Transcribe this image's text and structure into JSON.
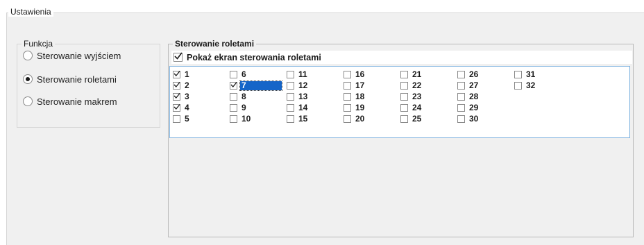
{
  "settings": {
    "title": "Ustawienia"
  },
  "funkcja": {
    "title": "Funkcja",
    "options": [
      {
        "label": "Sterowanie wyjściem",
        "selected": false
      },
      {
        "label": "Sterowanie roletami",
        "selected": true
      },
      {
        "label": "Sterowanie makrem",
        "selected": false
      }
    ]
  },
  "rolety": {
    "title": "Sterowanie roletami",
    "show_screen": {
      "label": "Pokaż ekran sterowania roletami",
      "checked": true
    },
    "focused_item": "7",
    "items": [
      {
        "label": "1",
        "checked": true
      },
      {
        "label": "2",
        "checked": true
      },
      {
        "label": "3",
        "checked": true
      },
      {
        "label": "4",
        "checked": true
      },
      {
        "label": "5",
        "checked": false
      },
      {
        "label": "6",
        "checked": false
      },
      {
        "label": "7",
        "checked": true
      },
      {
        "label": "8",
        "checked": false
      },
      {
        "label": "9",
        "checked": false
      },
      {
        "label": "10",
        "checked": false
      },
      {
        "label": "11",
        "checked": false
      },
      {
        "label": "12",
        "checked": false
      },
      {
        "label": "13",
        "checked": false
      },
      {
        "label": "14",
        "checked": false
      },
      {
        "label": "15",
        "checked": false
      },
      {
        "label": "16",
        "checked": false
      },
      {
        "label": "17",
        "checked": false
      },
      {
        "label": "18",
        "checked": false
      },
      {
        "label": "19",
        "checked": false
      },
      {
        "label": "20",
        "checked": false
      },
      {
        "label": "21",
        "checked": false
      },
      {
        "label": "22",
        "checked": false
      },
      {
        "label": "23",
        "checked": false
      },
      {
        "label": "24",
        "checked": false
      },
      {
        "label": "25",
        "checked": false
      },
      {
        "label": "26",
        "checked": false
      },
      {
        "label": "27",
        "checked": false
      },
      {
        "label": "28",
        "checked": false
      },
      {
        "label": "29",
        "checked": false
      },
      {
        "label": "30",
        "checked": false
      },
      {
        "label": "31",
        "checked": false
      },
      {
        "label": "32",
        "checked": false
      }
    ]
  }
}
